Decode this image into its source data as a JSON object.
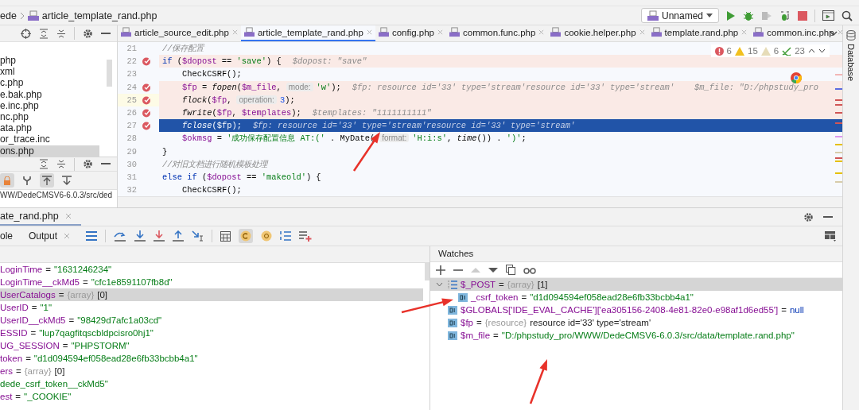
{
  "breadcrumb": [
    "ede",
    "article_template_rand.php"
  ],
  "run_config": {
    "label": "Unnamed"
  },
  "project_files": [
    {
      "name": "php",
      "selected": false
    },
    {
      "name": "xml",
      "selected": false
    },
    {
      "name": "c.php",
      "selected": false
    },
    {
      "name": "e.bak.php",
      "selected": false
    },
    {
      "name": "e.inc.php",
      "selected": false
    },
    {
      "name": "nc.php",
      "selected": false
    },
    {
      "name": "ata.php",
      "selected": false
    },
    {
      "name": "or_trace.inc",
      "selected": false
    },
    {
      "name": "ons.php",
      "selected": true
    }
  ],
  "structure_path": "WW/DedeCMSV6-6.0.3/src/ded",
  "editor": {
    "tabs": [
      {
        "label": "article_source_edit.php",
        "selected": false
      },
      {
        "label": "article_template_rand.php",
        "selected": true
      },
      {
        "label": "config.php",
        "selected": false
      },
      {
        "label": "common.func.php",
        "selected": false
      },
      {
        "label": "cookie.helper.php",
        "selected": false
      },
      {
        "label": "template.rand.php",
        "selected": false
      },
      {
        "label": "common.inc.php",
        "selected": false
      }
    ],
    "inspections": {
      "errors": "6",
      "warnings": "15",
      "weak_warnings": "6",
      "typos": "23"
    },
    "lines": [
      {
        "number": "21",
        "breakpoint": false,
        "caret": false,
        "current": false,
        "indented": false,
        "tokens": [
          {
            "kind": "comment",
            "text": "//保存配置"
          }
        ]
      },
      {
        "number": "22",
        "breakpoint": true,
        "caret": false,
        "current": false,
        "indented": false,
        "tokens": [
          {
            "kind": "kw",
            "text": "if"
          },
          {
            "kind": "plain",
            "text": " ("
          },
          {
            "kind": "var",
            "text": "$dopost"
          },
          {
            "kind": "plain",
            "text": " == "
          },
          {
            "kind": "str",
            "text": "'save'"
          },
          {
            "kind": "plain",
            "text": ") {"
          },
          {
            "kind": "hint",
            "text": "$dopost: \"save\""
          }
        ]
      },
      {
        "number": "23",
        "breakpoint": false,
        "caret": false,
        "current": false,
        "indented": true,
        "tokens": [
          {
            "kind": "plain",
            "text": "CheckCSRF();"
          }
        ]
      },
      {
        "number": "24",
        "breakpoint": true,
        "caret": false,
        "current": false,
        "indented": true,
        "tokens": [
          {
            "kind": "var",
            "text": "$fp"
          },
          {
            "kind": "plain",
            "text": " = "
          },
          {
            "kind": "func",
            "text": "fopen"
          },
          {
            "kind": "plain",
            "text": "("
          },
          {
            "kind": "var",
            "text": "$m_file"
          },
          {
            "kind": "plain",
            "text": ","
          },
          {
            "kind": "param",
            "text": "mode:"
          },
          {
            "kind": "str",
            "text": "'w'"
          },
          {
            "kind": "plain",
            "text": ");"
          },
          {
            "kind": "hint",
            "text": "$fp: resource id='33' type='stream'resource id='33' type='stream'    $m_file: \"D:/phpstudy_pro"
          }
        ]
      },
      {
        "number": "25",
        "breakpoint": true,
        "caret": true,
        "current": false,
        "indented": true,
        "tokens": [
          {
            "kind": "func",
            "text": "flock"
          },
          {
            "kind": "plain",
            "text": "("
          },
          {
            "kind": "var",
            "text": "$fp"
          },
          {
            "kind": "plain",
            "text": ","
          },
          {
            "kind": "param",
            "text": "operation:"
          },
          {
            "kind": "num",
            "text": "3"
          },
          {
            "kind": "plain",
            "text": ");"
          }
        ]
      },
      {
        "number": "26",
        "breakpoint": true,
        "caret": false,
        "current": false,
        "indented": true,
        "tokens": [
          {
            "kind": "func",
            "text": "fwrite"
          },
          {
            "kind": "plain",
            "text": "("
          },
          {
            "kind": "var",
            "text": "$fp"
          },
          {
            "kind": "plain",
            "text": ", "
          },
          {
            "kind": "var",
            "text": "$templates"
          },
          {
            "kind": "plain",
            "text": ");"
          },
          {
            "kind": "hint",
            "text": "$templates: \"1111111111\""
          }
        ]
      },
      {
        "number": "27",
        "breakpoint": true,
        "caret": false,
        "current": true,
        "indented": true,
        "tokens": [
          {
            "kind": "func",
            "text": "fclose"
          },
          {
            "kind": "plain",
            "text": "("
          },
          {
            "kind": "var",
            "text": "$fp"
          },
          {
            "kind": "plain",
            "text": ");"
          },
          {
            "kind": "hint",
            "text": "$fp: resource id='33' type='stream'resource id='33' type='stream'"
          }
        ]
      },
      {
        "number": "28",
        "breakpoint": false,
        "caret": false,
        "current": false,
        "indented": true,
        "tokens": [
          {
            "kind": "var",
            "text": "$okmsg"
          },
          {
            "kind": "plain",
            "text": " = "
          },
          {
            "kind": "str",
            "text": "'成功保存配置信息 AT:('"
          },
          {
            "kind": "plain",
            "text": " . MyDate("
          },
          {
            "kind": "param",
            "text": "format:"
          },
          {
            "kind": "str",
            "text": "'H:i:s'"
          },
          {
            "kind": "plain",
            "text": ", "
          },
          {
            "kind": "func",
            "text": "time"
          },
          {
            "kind": "plain",
            "text": "()) . "
          },
          {
            "kind": "str",
            "text": "')'"
          },
          {
            "kind": "plain",
            "text": ";"
          }
        ]
      },
      {
        "number": "29",
        "breakpoint": false,
        "caret": false,
        "current": false,
        "indented": false,
        "tokens": [
          {
            "kind": "plain",
            "text": "}"
          }
        ]
      },
      {
        "number": "30",
        "breakpoint": false,
        "caret": false,
        "current": false,
        "indented": false,
        "tokens": [
          {
            "kind": "comment",
            "text": "//对旧文档进行随机模板处理"
          }
        ]
      },
      {
        "number": "31",
        "breakpoint": false,
        "caret": false,
        "current": false,
        "indented": false,
        "tokens": [
          {
            "kind": "kw",
            "text": "else if"
          },
          {
            "kind": "plain",
            "text": " ("
          },
          {
            "kind": "var",
            "text": "$dopost"
          },
          {
            "kind": "plain",
            "text": " == "
          },
          {
            "kind": "str",
            "text": "'makeold'"
          },
          {
            "kind": "plain",
            "text": ") {"
          }
        ]
      },
      {
        "number": "32",
        "breakpoint": false,
        "caret": false,
        "current": false,
        "indented": true,
        "tokens": [
          {
            "kind": "plain",
            "text": "CheckCSRF();"
          }
        ]
      }
    ]
  },
  "debug": {
    "session_tab": "ate_rand.php",
    "tabs": [
      {
        "label": "ole",
        "selected": false
      },
      {
        "label": "Output",
        "selected": false
      }
    ],
    "variables": [
      {
        "name": "LoginTime",
        "op": "=",
        "kind": "string",
        "value": "\"1631246234\"",
        "selected": false
      },
      {
        "name": "LoginTime__ckMd5",
        "op": "=",
        "kind": "string",
        "value": "\"cfc1e8591107fb8d\"",
        "selected": false
      },
      {
        "name": "UserCatalogs",
        "op": "=",
        "kind": "array",
        "type": "{array}",
        "value": "[0]",
        "selected": true
      },
      {
        "name": "UserID",
        "op": "=",
        "kind": "string",
        "value": "\"1\"",
        "selected": false
      },
      {
        "name": "UserID__ckMd5",
        "op": "=",
        "kind": "string",
        "value": "\"98429d7afc1a03cd\"",
        "selected": false
      },
      {
        "name": "ESSID",
        "op": "=",
        "kind": "string",
        "value": "\"lup7qagfitqscbldpcisro0hj1\"",
        "selected": false
      },
      {
        "name": "UG_SESSION",
        "op": "=",
        "kind": "string",
        "value": "\"PHPSTORM\"",
        "selected": false
      },
      {
        "name": "token",
        "op": "=",
        "kind": "string",
        "value": "\"d1d094594ef058ead28e6fb33bcbb4a1\"",
        "selected": false
      },
      {
        "name": "ers",
        "op": "=",
        "kind": "array",
        "type": "{array}",
        "value": "[0]",
        "selected": false
      },
      {
        "kind": "string",
        "value": "dede_csrf_token__ckMd5\"",
        "selected": false
      },
      {
        "name": "est",
        "op": "=",
        "kind": "string",
        "value": "\"_COOKIE\"",
        "selected": false
      }
    ],
    "watches_title": "Watches",
    "watches": [
      {
        "name": "$_POST",
        "op": "=",
        "kind": "array",
        "type": "{array}",
        "value": "[1]",
        "selected": true,
        "expanded": true,
        "children": [
          {
            "name": "_csrf_token",
            "op": "=",
            "kind": "string",
            "value": "\"d1d094594ef058ead28e6fb33bcbb4a1\"",
            "selected": false
          }
        ]
      },
      {
        "name": "$GLOBALS['IDE_EVAL_CACHE']['ea305156-2408-4e81-82e0-e98af1d6ed55']",
        "op": "=",
        "kind": "null",
        "value": "null",
        "selected": false
      },
      {
        "name": "$fp",
        "op": "=",
        "kind": "resource",
        "type": "{resource}",
        "value": "resource id='33' type='stream'",
        "selected": false
      },
      {
        "name": "$m_file",
        "op": "=",
        "kind": "string",
        "value": "\"D:/phpstudy_pro/WWW/DedeCMSV6-6.0.3/src/data/template.rand.php\"",
        "selected": false
      }
    ]
  },
  "side_strip": {
    "label": "Database"
  }
}
